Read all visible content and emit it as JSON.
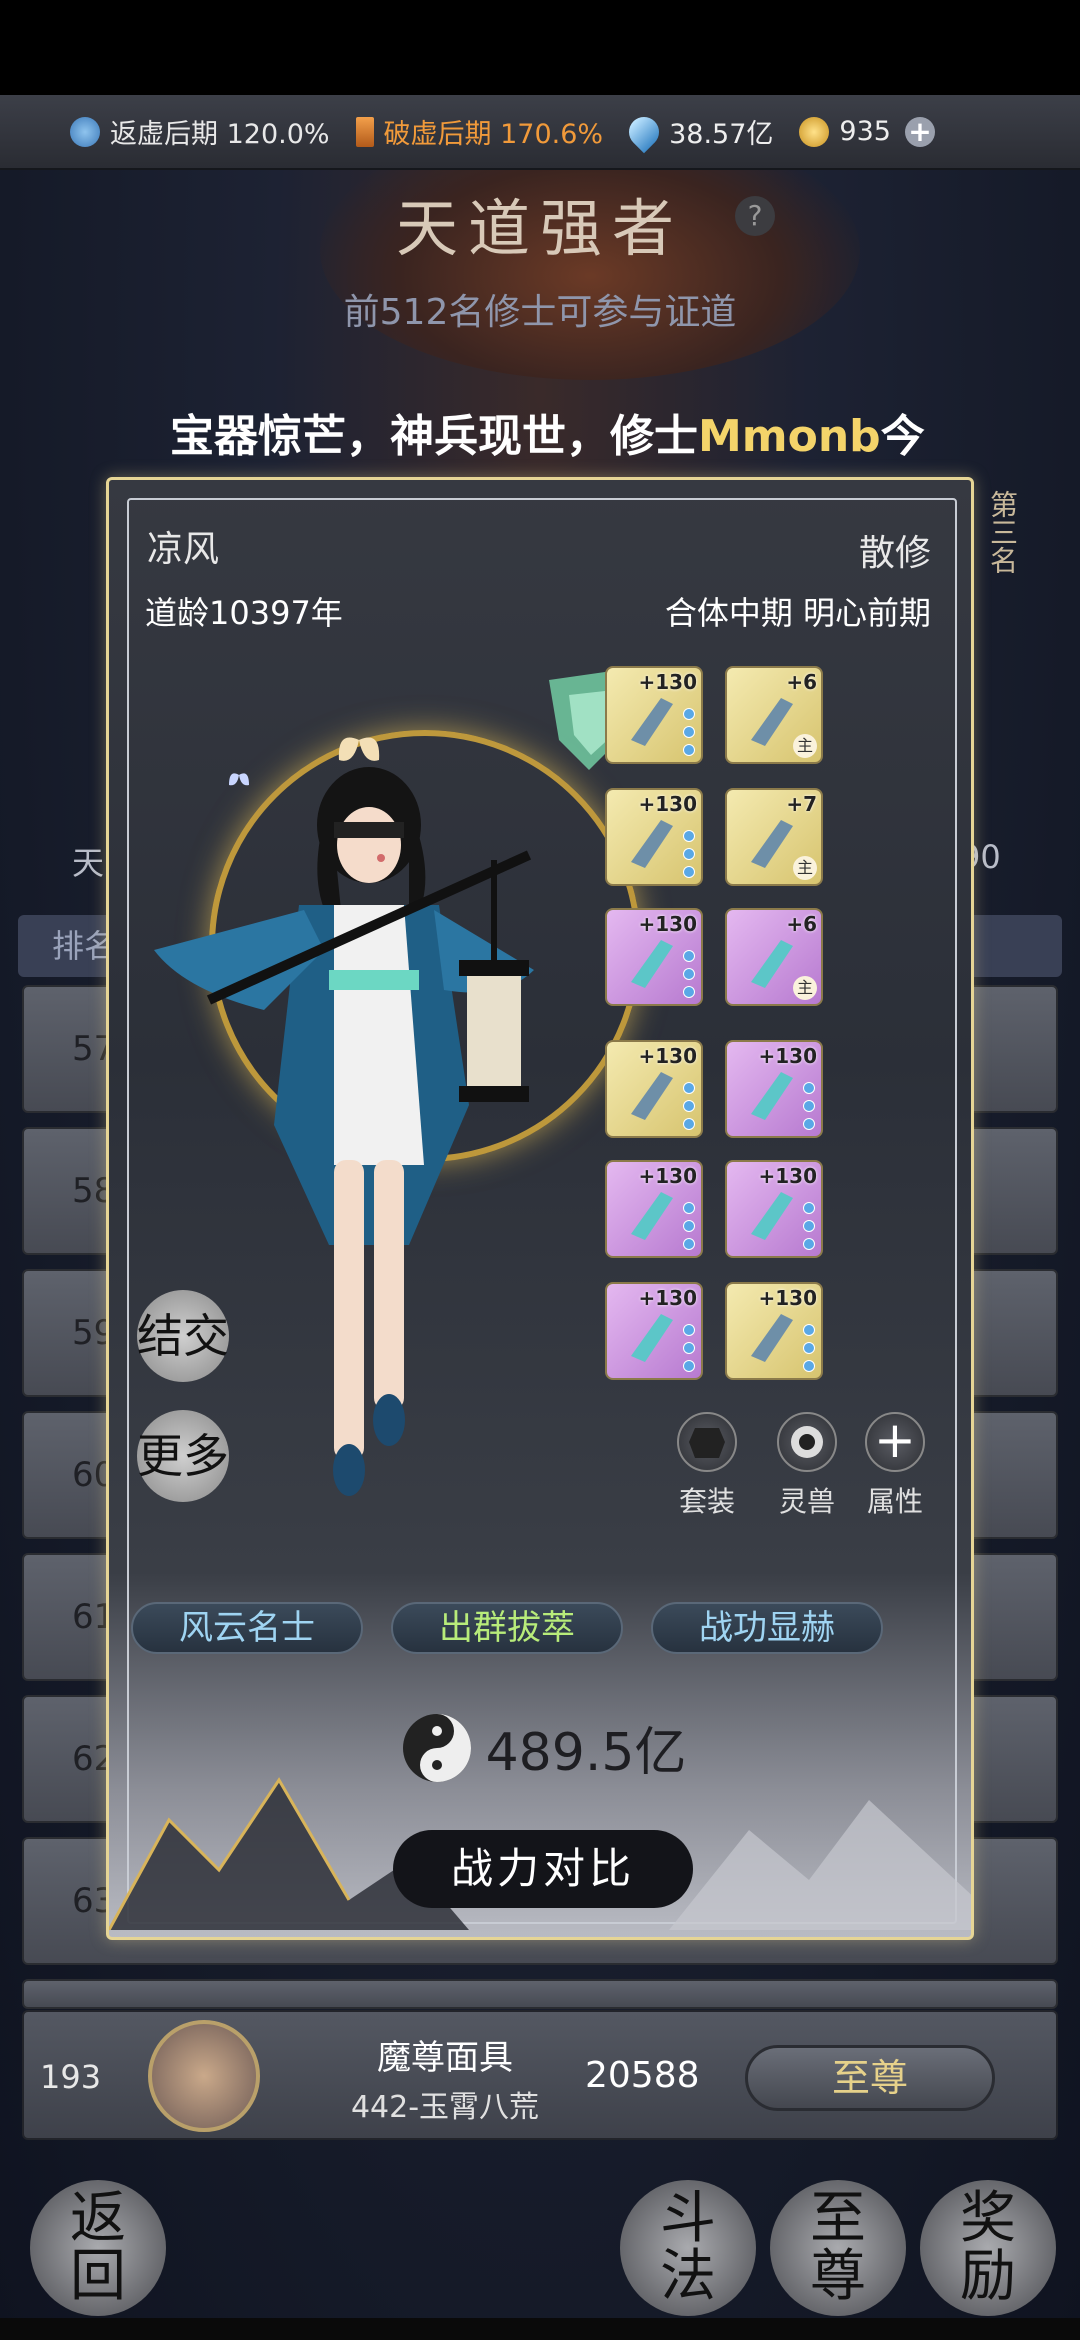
{
  "resources": [
    {
      "label": "返虚后期 120.0%",
      "color": "#e8e8e8",
      "icon": "yin-yang-blue-icon"
    },
    {
      "label": "破虚后期 170.6%",
      "color": "#f19a3a",
      "icon": "sword-icon"
    },
    {
      "label": "38.57亿",
      "color": "#e8e8e8",
      "icon": "spirit-crystal-icon"
    },
    {
      "label": "935",
      "color": "#e8e8e8",
      "icon": "gold-coin-icon"
    }
  ],
  "header": {
    "title": "天道强者",
    "help": "?",
    "subtitle": "前512名修士可参与证道"
  },
  "marquee": {
    "prefix": "宝器惊芒，神兵现世，修士",
    "highlight": "Mmonb",
    "suffix": "今日对"
  },
  "background": {
    "third_place": "第三名",
    "left_label": "天",
    "right_label": "90",
    "rank_header": "排名",
    "rows": [
      "57",
      "58",
      "59",
      "60",
      "61",
      "62",
      "63"
    ]
  },
  "profile": {
    "name": "凉风",
    "sect": "散修",
    "age": "道龄10397年",
    "realm": "合体中期 明心前期",
    "equipment": [
      {
        "level": "+130",
        "rarity": "yellow",
        "main": false
      },
      {
        "level": "+6",
        "rarity": "yellow",
        "main": true
      },
      {
        "level": "+130",
        "rarity": "yellow",
        "main": false
      },
      {
        "level": "+7",
        "rarity": "yellow",
        "main": true
      },
      {
        "level": "+130",
        "rarity": "purple",
        "main": false
      },
      {
        "level": "+6",
        "rarity": "purple",
        "main": true
      },
      {
        "level": "+130",
        "rarity": "yellow",
        "main": false
      },
      {
        "level": "+130",
        "rarity": "purple",
        "main": false
      },
      {
        "level": "+130",
        "rarity": "purple",
        "main": false
      },
      {
        "level": "+130",
        "rarity": "purple",
        "main": false
      },
      {
        "level": "+130",
        "rarity": "purple",
        "main": false
      },
      {
        "level": "+130",
        "rarity": "yellow",
        "main": false
      }
    ],
    "main_mark": "主",
    "controls": {
      "set": "套装",
      "beast": "灵兽",
      "attr": "属性",
      "attr_symbol": "+"
    },
    "side": {
      "befriend": "结交",
      "more": "更多"
    },
    "titles": [
      "风云名士",
      "出群拔萃",
      "战功显赫"
    ],
    "power": "489.5亿",
    "compare": "战力对比"
  },
  "my_entry": {
    "rank": "193",
    "name": "魔尊面具",
    "server": "442-玉霄八荒",
    "score": "20588",
    "tier": "至尊"
  },
  "bottom_nav": {
    "back": "返回",
    "duel": "斗法",
    "supreme": "至尊",
    "reward": "奖励"
  }
}
